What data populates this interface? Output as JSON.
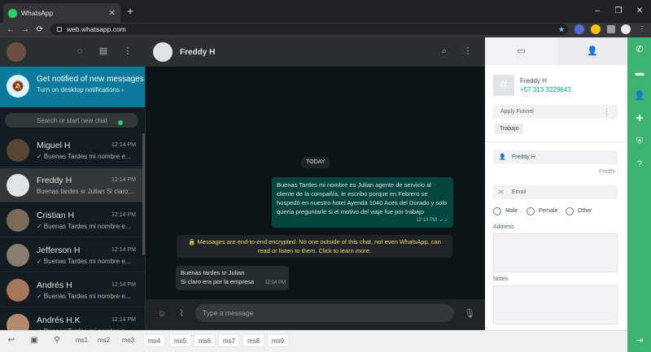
{
  "browser": {
    "tab_title": "WhatsApp",
    "tab_close": "✕",
    "new_tab": "+",
    "url": "web.whatsapp.com",
    "win_min": "–",
    "win_max": "❐",
    "win_close": "✕",
    "back": "←",
    "forward": "→",
    "reload": "⟳",
    "star": "★"
  },
  "left": {
    "notify_title": "Get notified of new messages",
    "notify_sub": "Turn on desktop notifications ›",
    "search_placeholder": "Search or start new chat",
    "chats": [
      {
        "name": "Miguel H",
        "time": "12:14 PM",
        "msg": "✓ Buenas Tardes mi nombre e...",
        "avatar_color": "#5a4535"
      },
      {
        "name": "Freddy H",
        "time": "12:14 PM",
        "msg": "Buenas tardes sr Julian Si claro...",
        "avatar_color": "#dfe5e7"
      },
      {
        "name": "Cristian H",
        "time": "12:14 PM",
        "msg": "✓ Buenas Tardes mi nombre e...",
        "avatar_color": "#7a6a5a"
      },
      {
        "name": "Jefferson H",
        "time": "12:14 PM",
        "msg": "✓ Buenas Tardes mi nombre e...",
        "avatar_color": "#8a7d70"
      },
      {
        "name": "Andrés H",
        "time": "12:14 PM",
        "msg": "✓ Buenas Tardes mi nombre e...",
        "avatar_color": "#a8765a"
      },
      {
        "name": "Andrés H.K",
        "time": "12:14 PM",
        "msg": "✓ Buenas Tardes mi nombre e...",
        "avatar_color": "#b38a6e"
      }
    ]
  },
  "chat": {
    "contact_name": "Freddy H",
    "date_label": "TODAY",
    "outgoing": {
      "text": "Buenas Tardes mi nombre es Julian agente de servicio al cliente de la compañía, le escribo porque en Febrero se hospedó en nuestro hotel Ayenda 1040 Aces del Dorado y solo quería preguntarle si el motivo del viaje fue por trabajo",
      "time": "12:13 PM",
      "check": "✓✓"
    },
    "encryption": "🔒 Messages are end-to-end encrypted. No one outside of this chat, not even WhatsApp, can read or listen to them. Click to learn more.",
    "incoming": {
      "line1": "Buenas tardes sr Julian",
      "line2": "Si claro era por la empresa",
      "time": "12:14 PM"
    },
    "input_placeholder": "Type a message"
  },
  "crm": {
    "contact_name": "Freddy H",
    "phone": "+57 313 3229643",
    "funnel_label": "Apply Funnel",
    "tag": "Trabajo",
    "name_value": "Freddy H",
    "nickname": "Fredhi",
    "email_placeholder": "Email",
    "gender_options": [
      "Male",
      "Female",
      "Other"
    ],
    "address_label": "Address",
    "notes_label": "Notes"
  },
  "quick_replies": [
    "ms1",
    "ms2",
    "ms3",
    "ms4",
    "ms5",
    "ms6",
    "ms7",
    "ms8",
    "ms9"
  ],
  "colors": {
    "accent": "#3cb371",
    "banner": "#0b7a9b",
    "bubble_out": "#054740"
  }
}
